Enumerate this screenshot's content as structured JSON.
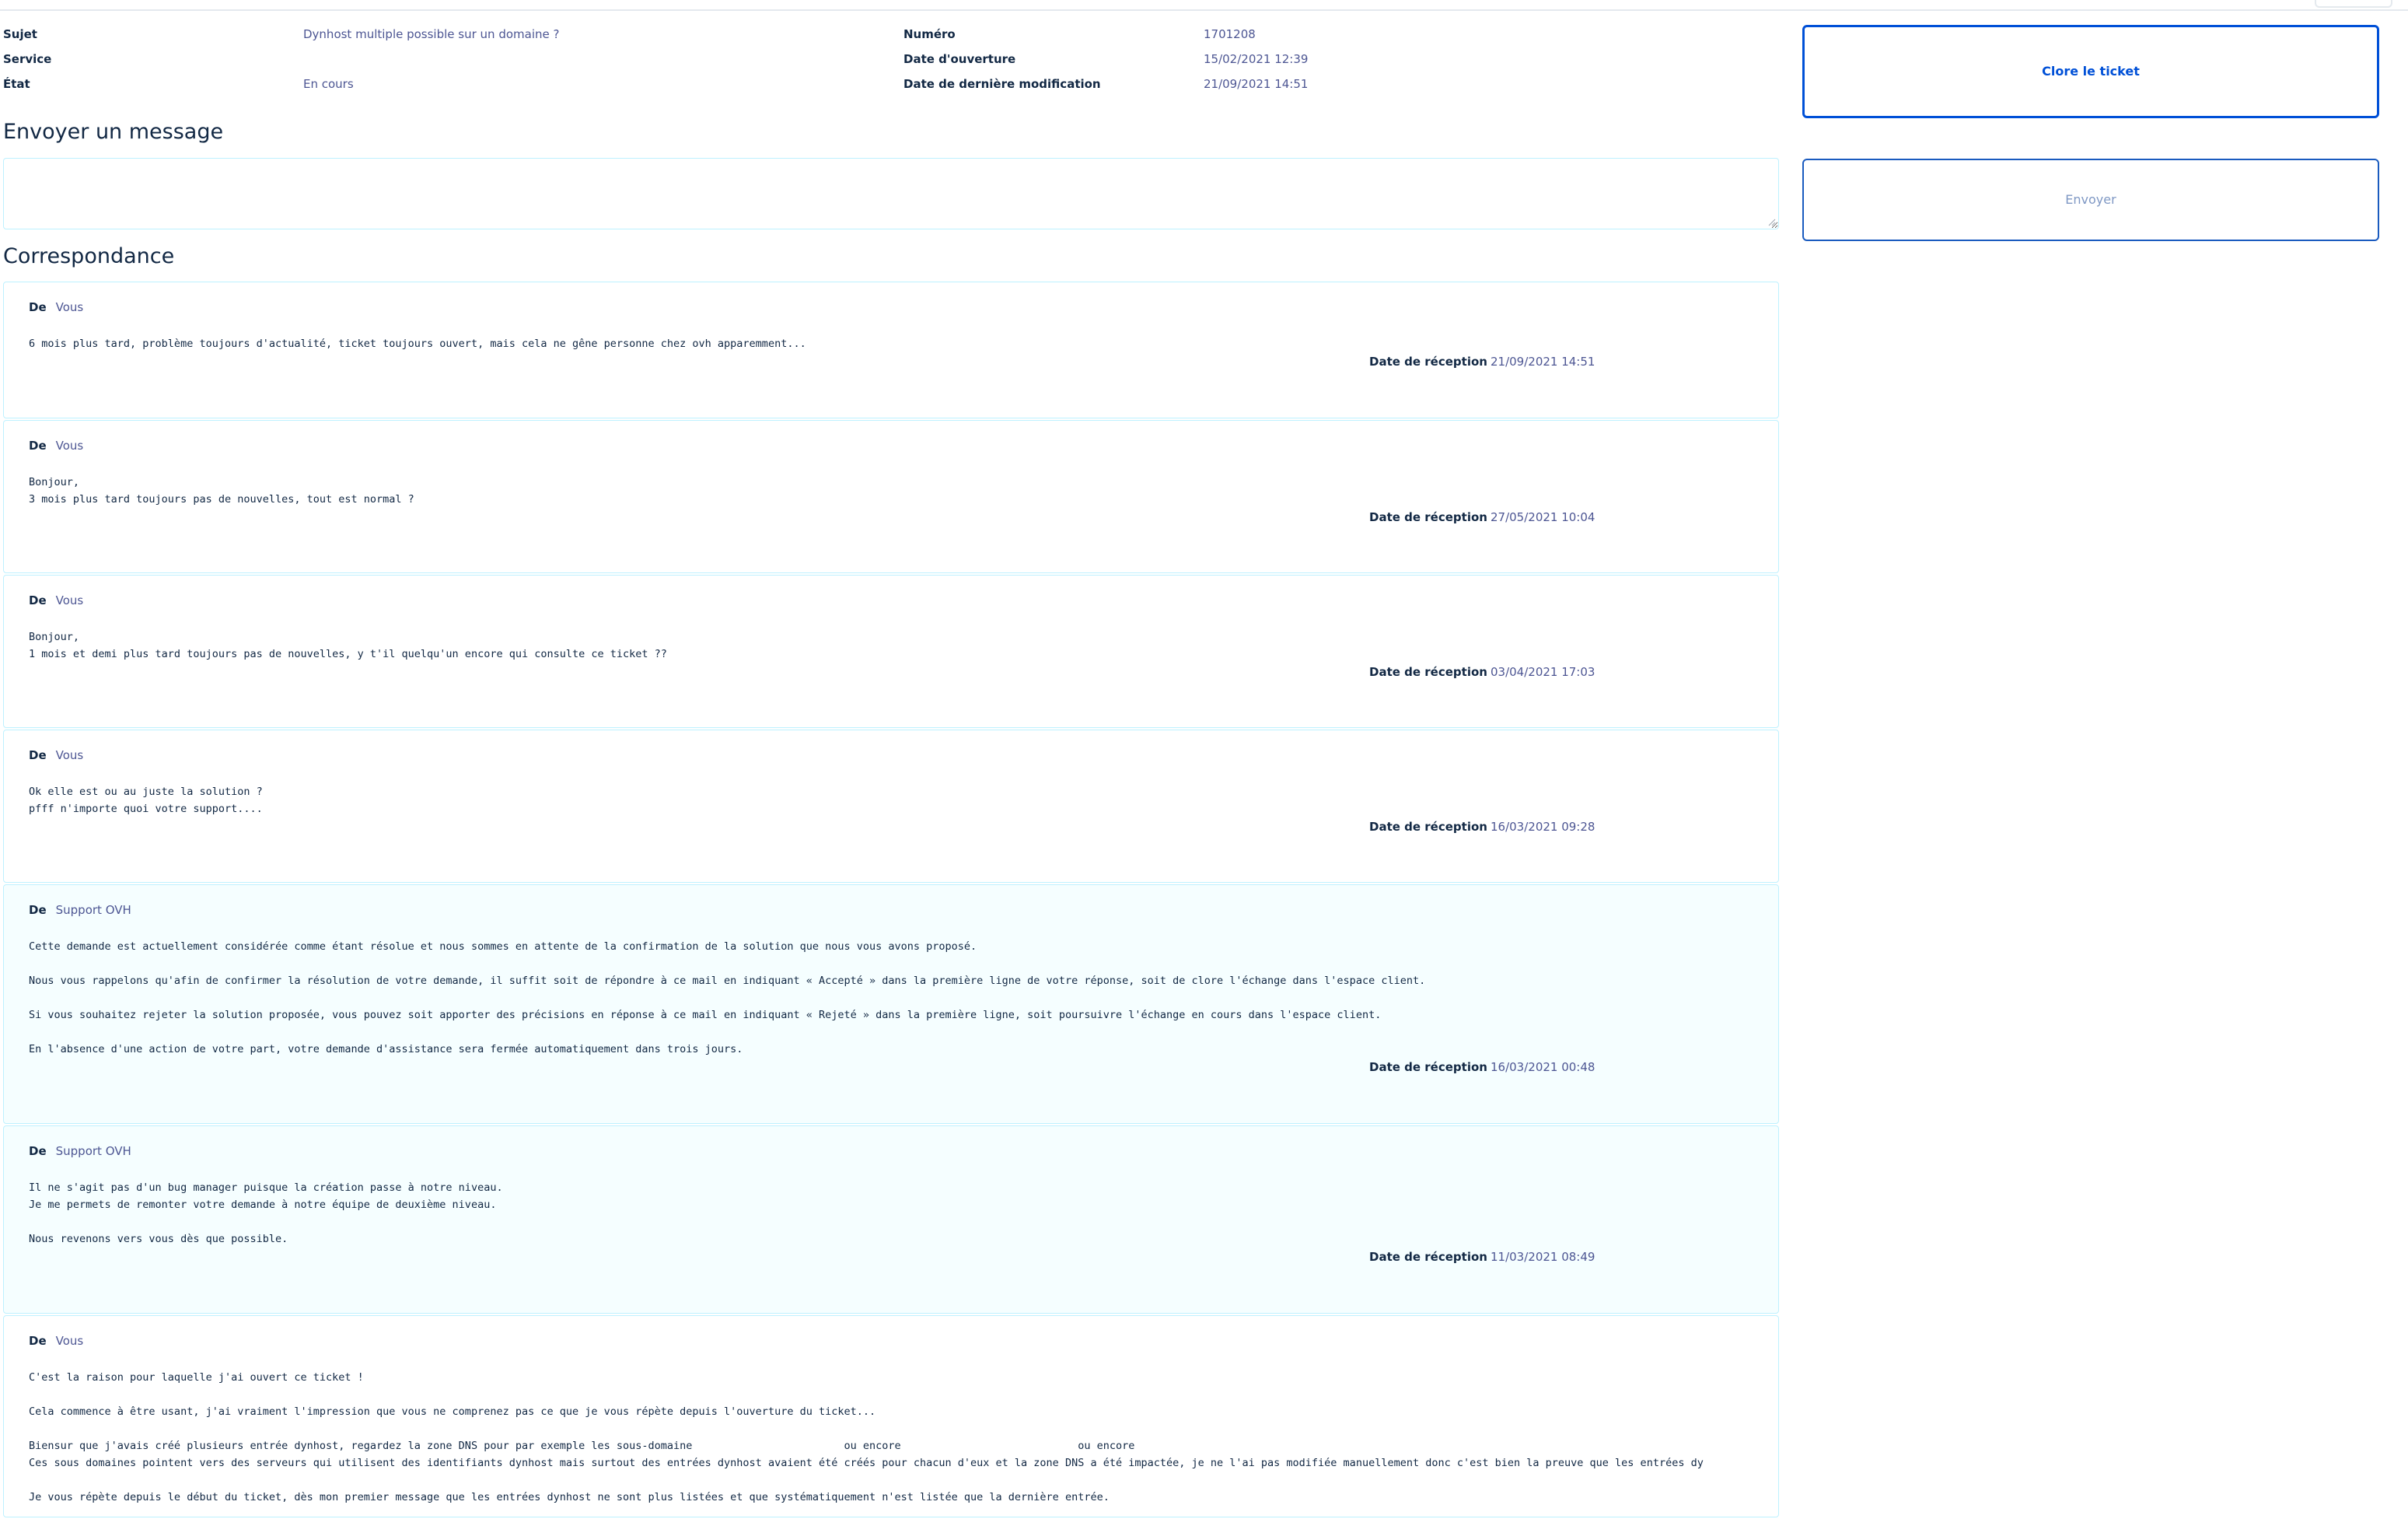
{
  "ticket": {
    "subject_label": "Sujet",
    "subject": "Dynhost multiple possible sur un domaine ?",
    "service_label": "Service",
    "service": "",
    "state_label": "État",
    "state": "En cours",
    "number_label": "Numéro",
    "number": "1701208",
    "opened_label": "Date d'ouverture",
    "opened": "15/02/2021 12:39",
    "modified_label": "Date de dernière modification",
    "modified": "21/09/2021 14:51"
  },
  "actions": {
    "close_label": "Clore le ticket",
    "send_label": "Envoyer"
  },
  "compose": {
    "heading": "Envoyer un message",
    "placeholder": ""
  },
  "correspondence": {
    "heading": "Correspondance",
    "from_label": "De",
    "received_label": "Date de réception",
    "messages": [
      {
        "from": "Vous",
        "body": "6 mois plus tard, problème toujours d'actualité, ticket toujours ouvert, mais cela ne gêne personne chez ovh apparemment...",
        "received": "21/09/2021 14:51"
      },
      {
        "from": "Vous",
        "body": "Bonjour,\n3 mois plus tard toujours pas de nouvelles, tout est normal ?",
        "received": "27/05/2021 10:04"
      },
      {
        "from": "Vous",
        "body": "Bonjour,\n1 mois et demi plus tard toujours pas de nouvelles, y t'il quelqu'un encore qui consulte ce ticket ??",
        "received": "03/04/2021 17:03"
      },
      {
        "from": "Vous",
        "body": "Ok elle est ou au juste la solution ?\npfff n'importe quoi votre support....",
        "received": "16/03/2021 09:28"
      },
      {
        "from": "Support OVH",
        "body": "Cette demande est actuellement considérée comme étant résolue et nous sommes en attente de la confirmation de la solution que nous vous avons proposé.\n\nNous vous rappelons qu'afin de confirmer la résolution de votre demande, il suffit soit de répondre à ce mail en indiquant « Accepté » dans la première ligne de votre réponse, soit de clore l'échange dans l'espace client.\n\nSi vous souhaitez rejeter la solution proposée, vous pouvez soit apporter des précisions en réponse à ce mail en indiquant « Rejeté » dans la première ligne, soit poursuivre l'échange en cours dans l'espace client.\n\nEn l'absence d'une action de votre part, votre demande d'assistance sera fermée automatiquement dans trois jours.",
        "received": "16/03/2021 00:48"
      },
      {
        "from": "Support OVH",
        "body": "Il ne s'agit pas d'un bug manager puisque la création passe à notre niveau.\nJe me permets de remonter votre demande à notre équipe de deuxième niveau.\n\nNous revenons vers vous dès que possible.",
        "received": "11/03/2021 08:49"
      },
      {
        "from": "Vous",
        "body": "C'est la raison pour laquelle j'ai ouvert ce ticket !\n\nCela commence à être usant, j'ai vraiment l'impression que vous ne comprenez pas ce que je vous répète depuis l'ouverture du ticket...\n\nBiensur que j'avais créé plusieurs entrée dynhost, regardez la zone DNS pour par exemple les sous-domaine                        ou encore                            ou encore\nCes sous domaines pointent vers des serveurs qui utilisent des identifiants dynhost mais surtout des entrées dynhost avaient été créés pour chacun d'eux et la zone DNS a été impactée, je ne l'ai pas modifiée manuellement donc c'est bien la preuve que les entrées dy\n\nJe vous répète depuis le début du ticket, dès mon premier message que les entrées dynhost ne sont plus listées et que systématiquement n'est listée que la dernière entrée.",
        "received": ""
      }
    ]
  }
}
